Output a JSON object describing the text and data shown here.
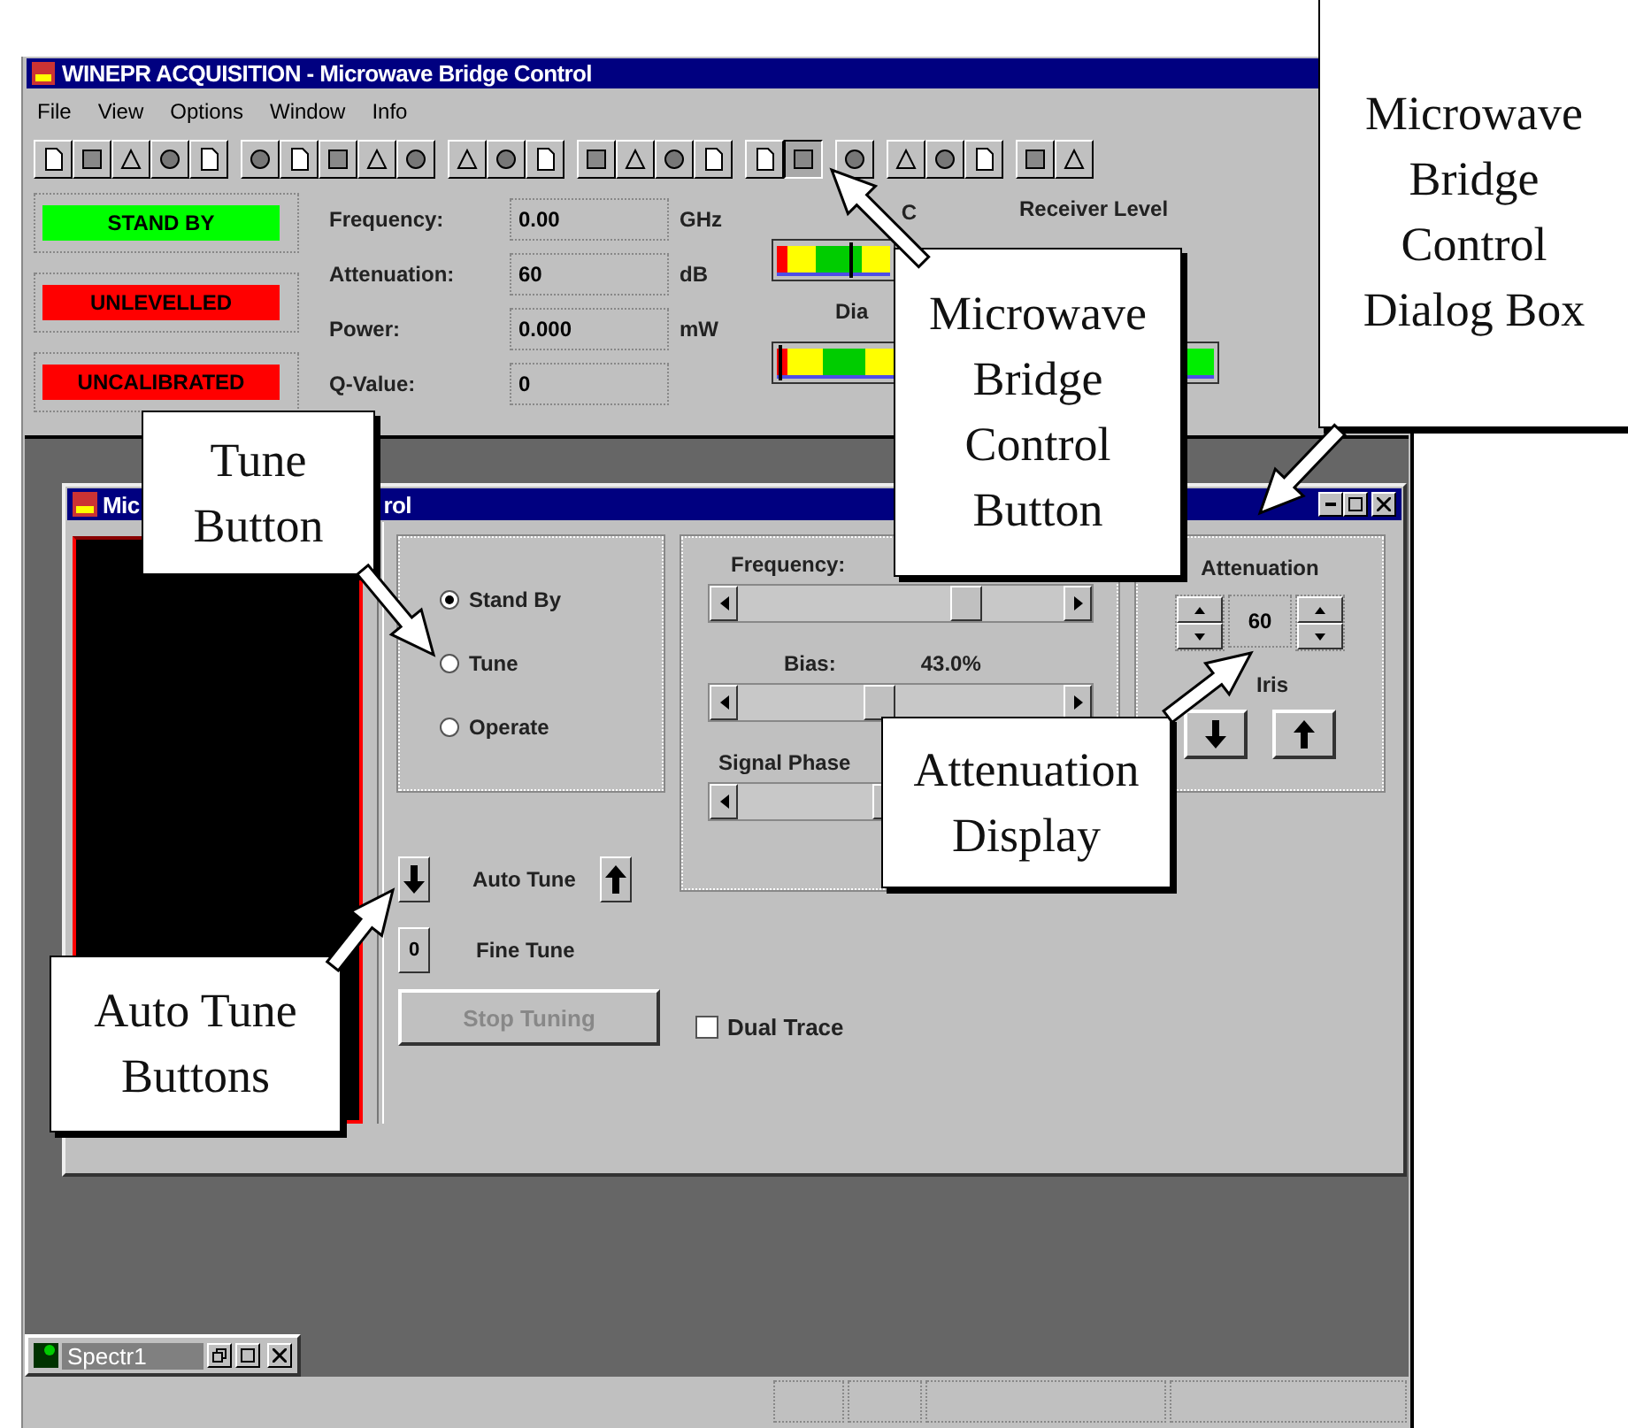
{
  "window": {
    "title": "WINEPR ACQUISITION - Microwave Bridge Control"
  },
  "menu": [
    {
      "label": "File"
    },
    {
      "label": "View"
    },
    {
      "label": "Options"
    },
    {
      "label": "Window"
    },
    {
      "label": "Info"
    }
  ],
  "status_indicators": [
    {
      "label": "STAND BY",
      "color": "#00ff00"
    },
    {
      "label": "UNLEVELLED",
      "color": "#ff0000"
    },
    {
      "label": "UNCALIBRATED",
      "color": "#ff0000"
    }
  ],
  "readouts": [
    {
      "label": "Frequency:",
      "value": "0.00",
      "unit": "GHz"
    },
    {
      "label": "Attenuation:",
      "value": "60",
      "unit": "dB"
    },
    {
      "label": "Power:",
      "value": "0.000",
      "unit": "mW"
    },
    {
      "label": "Q-Value:",
      "value": "0"
    }
  ],
  "meters": {
    "afc_label": "C",
    "receiver_label": "Receiver Level",
    "diode_label": "Dia"
  },
  "dialog": {
    "title_start": "Mic",
    "title_end": "rol",
    "modes": [
      {
        "label": "Stand By",
        "selected": true
      },
      {
        "label": "Tune",
        "selected": false
      },
      {
        "label": "Operate",
        "selected": false
      }
    ],
    "auto_tune_label": "Auto Tune",
    "fine_tune_label": "Fine Tune",
    "fine_tune_button": "0",
    "stop_button": {
      "label": "Stop Tuning",
      "disabled": true
    },
    "dual_trace": {
      "label": "Dual Trace",
      "checked": false
    },
    "sliders": [
      {
        "label": "Frequency:",
        "level": 0.72
      },
      {
        "label": "Bias:",
        "reading": "43.0%",
        "level": 0.43
      },
      {
        "label": "Signal Phase",
        "level": 0.46
      }
    ],
    "attenuation": {
      "label": "Attenuation",
      "value": "60",
      "iris_label": "Iris"
    }
  },
  "minimized_window": {
    "title": "Spectr1"
  },
  "callouts": [
    {
      "text": "Tune Button"
    },
    {
      "text": "Microwave Bridge Control Button"
    },
    {
      "text": "Microwave Bridge Control Dialog Box"
    },
    {
      "text": "Attenuation Display"
    },
    {
      "text": "Auto Tune Buttons"
    }
  ]
}
